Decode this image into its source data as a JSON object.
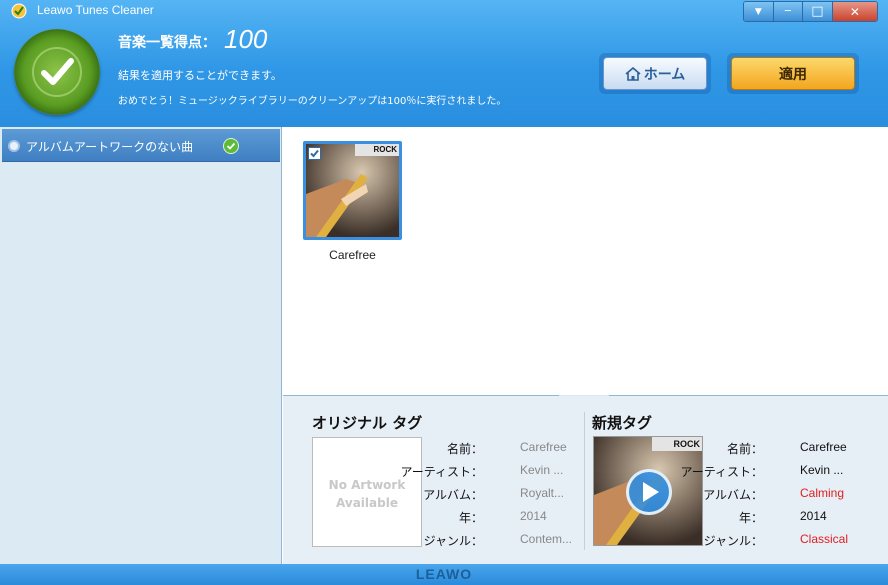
{
  "window": {
    "title": "Leawo Tunes Cleaner",
    "controls": {
      "dropdown": "▼",
      "minimize": "─",
      "maximize": "□",
      "close": "✕"
    }
  },
  "header": {
    "score_label": "音楽一覧得点：",
    "score_value": "100",
    "info_line1": "結果を適用することができます。",
    "info_line2": "おめでとう！ミュージックライブラリーのクリーンアップは100％に実行されました。",
    "home_button": "ホーム",
    "apply_button": "適用"
  },
  "sidebar": {
    "items": [
      {
        "label": "アルバムアートワークのない曲"
      }
    ]
  },
  "main": {
    "tracks": [
      {
        "title": "Carefree",
        "genre_tag": "ROCK",
        "checked": true
      }
    ]
  },
  "original_tags": {
    "title": "オリジナル タグ",
    "no_artwork_line1": "No Artwork",
    "no_artwork_line2": "Available",
    "fields": [
      {
        "key": "名前：",
        "value": "Carefree"
      },
      {
        "key": "アーティスト：",
        "value": "Kevin ..."
      },
      {
        "key": "アルバム：",
        "value": "Royalt..."
      },
      {
        "key": "年：",
        "value": "2014"
      },
      {
        "key": "ジャンル：",
        "value": "Contem..."
      }
    ]
  },
  "new_tags": {
    "title": "新規タグ",
    "genre_tag": "ROCK",
    "fields": [
      {
        "key": "名前：",
        "value": "Carefree"
      },
      {
        "key": "アーティスト：",
        "value": "Kevin ..."
      },
      {
        "key": "アルバム：",
        "value": "Calming"
      },
      {
        "key": "年：",
        "value": "2014"
      },
      {
        "key": "ジャンル：",
        "value": "Classical"
      }
    ]
  },
  "statusbar": {
    "brand": "LEAWO"
  },
  "colors": {
    "accent": "#2f97e6",
    "changed": "#e02020",
    "apply": "#f3a620"
  }
}
